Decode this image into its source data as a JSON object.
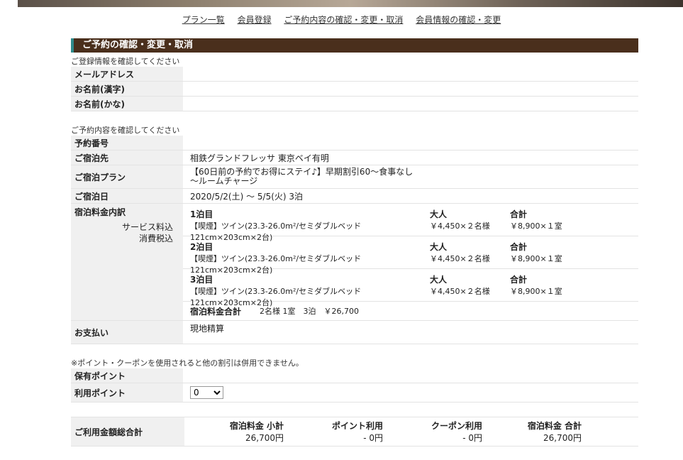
{
  "nav": {
    "items": [
      "プラン一覧",
      "会員登録",
      "ご予約内容の確認・変更・取消",
      "会員情報の確認・変更"
    ]
  },
  "section_title": "ご予約の確認・変更・取消",
  "member": {
    "note": "ご登録情報を確認してください",
    "email_label": "メールアドレス",
    "name_kanji_label": "お名前(漢字)",
    "name_kana_label": "お名前(かな)"
  },
  "reservation": {
    "note": "ご予約内容を確認してください",
    "number_label": "予約番号",
    "hotel_label": "ご宿泊先",
    "hotel_value": "相鉄グランドフレッサ 東京ベイ有明",
    "plan_label": "ご宿泊プラン",
    "plan_value": "【60日前の予約でお得にステイ♪】早期割引60～食事なし～ルームチャージ",
    "date_label": "ご宿泊日",
    "date_value": "2020/5/2(土) ～ 5/5(火) 3泊",
    "breakdown_label": "宿泊料金内訳",
    "breakdown_sub1": "サービス料込",
    "breakdown_sub2": "消費税込",
    "nights": [
      {
        "title": "1泊目",
        "room": "【喫煙】ツイン(23.3-26.0m²/セミダブルベッド121cm×203cm×2台)",
        "adult_label": "大人",
        "adult_value": "￥4,450×２名様",
        "total_label": "合計",
        "total_value": "￥8,900×１室"
      },
      {
        "title": "2泊目",
        "room": "【喫煙】ツイン(23.3-26.0m²/セミダブルベッド121cm×203cm×2台)",
        "adult_label": "大人",
        "adult_value": "￥4,450×２名様",
        "total_label": "合計",
        "total_value": "￥8,900×１室"
      },
      {
        "title": "3泊目",
        "room": "【喫煙】ツイン(23.3-26.0m²/セミダブルベッド121cm×203cm×2台)",
        "adult_label": "大人",
        "adult_value": "￥4,450×２名様",
        "total_label": "合計",
        "total_value": "￥8,900×１室"
      }
    ],
    "total_label": "宿泊料金合計",
    "total_value": "2名様 1室　3泊　￥26,700",
    "payment_label": "お支払い",
    "payment_value": "現地精算"
  },
  "points": {
    "note": "※ポイント・クーポンを使用されると他の割引は併用できません。",
    "held_label": "保有ポイント",
    "use_label": "利用ポイント",
    "use_value": "0"
  },
  "summary": {
    "label": "ご利用金額総合計",
    "cols": [
      {
        "label": "宿泊料金 小計",
        "value": "26,700円"
      },
      {
        "label": "ポイント利用",
        "value": "- 0円"
      },
      {
        "label": "クーポン利用",
        "value": "- 0円"
      },
      {
        "label": "宿泊料金 合計",
        "value": "26,700円"
      }
    ]
  }
}
